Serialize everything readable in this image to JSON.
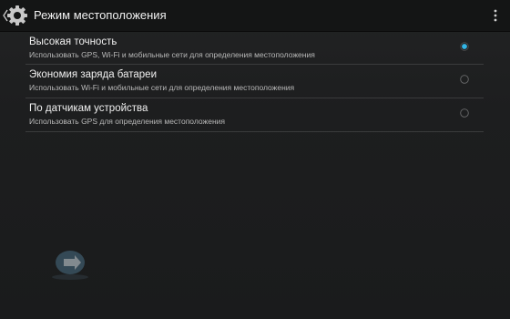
{
  "action_bar": {
    "title": "Режим местоположения",
    "back_icon": "chevron-left-icon",
    "app_icon": "settings-gear-icon",
    "overflow_icon": "overflow-menu-icon"
  },
  "location_modes": [
    {
      "title": "Высокая точность",
      "subtitle": "Использовать GPS, Wi-Fi и мобильные сети для определения местоположения",
      "selected": true
    },
    {
      "title": "Экономия заряда батареи",
      "subtitle": "Использовать Wi-Fi и мобильные сети для определения местоположения",
      "selected": false
    },
    {
      "title": "По датчикам устройства",
      "subtitle": "Использовать GPS для определения местоположения",
      "selected": false
    }
  ],
  "colors": {
    "accent": "#33b5e5",
    "action_bar": "#141515",
    "divider": "#3a3b3c"
  }
}
